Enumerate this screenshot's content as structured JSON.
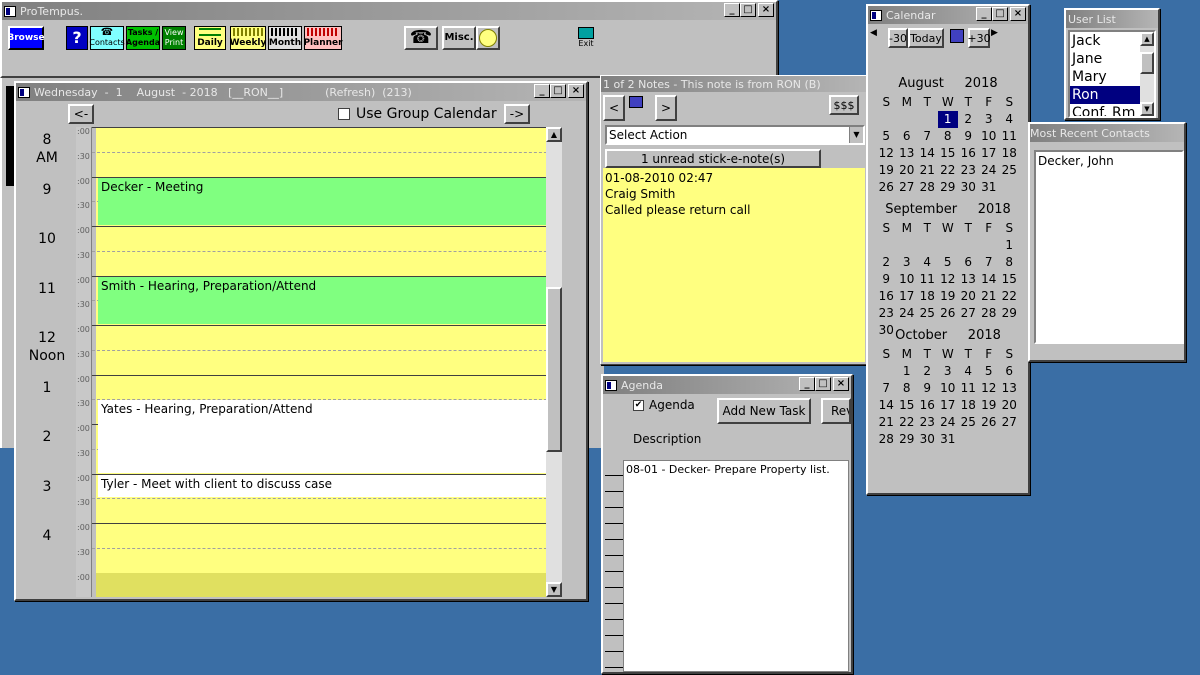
{
  "main_window": {
    "title": "ProTempus.",
    "toolbar": {
      "browse": "Browse",
      "help": "?",
      "contacts": "Contacts",
      "tasks_line1": "Tasks /",
      "tasks_line2": "Agenda",
      "view_line1": "View",
      "view_line2": "Print",
      "daily": "Daily",
      "weekly": "Weekly",
      "month": "Month",
      "planner": "Planner",
      "misc": "Misc.",
      "exit": "Exit"
    }
  },
  "day_view": {
    "title": "Wednesday  -  1    August  - 2018   [__RON__]            (Refresh)  (213)",
    "prev_button": "<-",
    "next_button": "->",
    "group_calendar_label": "Use Group Calendar",
    "group_calendar_checked": false,
    "hours": [
      {
        "label": "8",
        "sub": "AM"
      },
      {
        "label": "9",
        "sub": ""
      },
      {
        "label": "10",
        "sub": ""
      },
      {
        "label": "11",
        "sub": ""
      },
      {
        "label": "12",
        "sub": "Noon"
      },
      {
        "label": "1",
        "sub": ""
      },
      {
        "label": "2",
        "sub": ""
      },
      {
        "label": "3",
        "sub": ""
      },
      {
        "label": "4",
        "sub": ""
      }
    ],
    "min_00": ":00",
    "min_30": ":30",
    "appointments": [
      {
        "text": "Decker - Meeting",
        "color": "#80ff80"
      },
      {
        "text": "Smith - Hearing, Preparation/Attend",
        "color": "#80ff80"
      },
      {
        "text": "Yates - Hearing, Preparation/Attend",
        "color": "#ffffff"
      },
      {
        "text": "Tyler - Meet with client to discuss case",
        "color": "#ffffff"
      }
    ]
  },
  "notes": {
    "title": "1 of 2 Notes  - This note is from RON (B)",
    "prev": "<",
    "next": ">",
    "money": "$$$",
    "action_select": "Select Action",
    "unread_button": "1 unread stick-e-note(s)",
    "note_date": "01-08-2010 02:47",
    "note_from": "Craig Smith",
    "note_text": "Called please return call"
  },
  "agenda": {
    "title": "Agenda",
    "checkbox_label": "Agenda",
    "checked": true,
    "add_task": "Add New Task",
    "rev": "Rev",
    "description_label": "Description",
    "items": [
      "08-01 - Decker- Prepare Property list."
    ]
  },
  "calendar": {
    "title": "Calendar",
    "minus30": "-30",
    "today": "Today",
    "plus30": "+30",
    "weekdays": [
      "S",
      "M",
      "T",
      "W",
      "T",
      "F",
      "S"
    ],
    "months": [
      {
        "name": "August",
        "year": "2018",
        "offset": 3,
        "days": 31,
        "selected": 1
      },
      {
        "name": "September",
        "year": "2018",
        "offset": 6,
        "days": 30,
        "selected": 0
      },
      {
        "name": "October",
        "year": "2018",
        "offset": 1,
        "days": 31,
        "selected": 0
      }
    ]
  },
  "user_list": {
    "title": "User List",
    "users": [
      "Jack",
      "Jane",
      "Mary",
      "Ron",
      "Conf. Rm"
    ],
    "selected": "Ron"
  },
  "recent_contacts": {
    "title": "Most Recent Contacts",
    "contacts": [
      "Decker, John"
    ]
  }
}
